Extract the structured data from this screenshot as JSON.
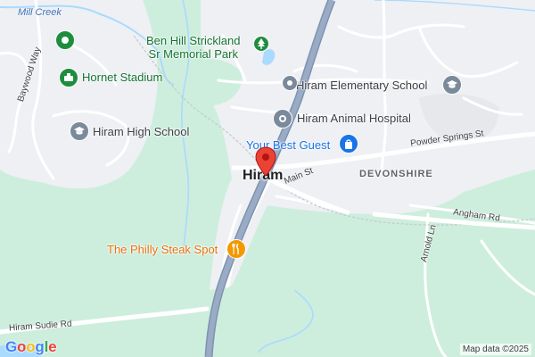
{
  "map": {
    "town": "Hiram",
    "neighborhood": "DEVONSHIRE",
    "places": [
      {
        "name": "Ben Hill Strickland",
        "name_line2": "Sr Memorial Park",
        "icon": "tree-icon",
        "color": "#1e8e3e"
      },
      {
        "name": "Hornet Stadium",
        "icon": "stadium-icon",
        "color": "#1e8e3e"
      },
      {
        "name": "Hiram High School",
        "icon": "school-icon",
        "color": "#7b8a9b"
      },
      {
        "name": "Hiram Elementary School",
        "icon": "school-icon",
        "color": "#7b8a9b"
      },
      {
        "name": "Hiram Animal Hospital",
        "icon": "medical-icon",
        "color": "#7b8a9b"
      },
      {
        "name": "Your Best Guest",
        "icon": "shopping-bag-icon",
        "color": "#1a73e8"
      },
      {
        "name": "The Philly Steak Spot",
        "icon": "restaurant-icon",
        "color": "#f29900"
      }
    ],
    "roads": {
      "mill_creek": "Mill Creek",
      "baywood": "Baywood Way",
      "powder_springs": "Powder Springs St",
      "main": "Main St",
      "angham": "Angham Rd",
      "arnold": "Arnold Ln",
      "hiram_sudie": "Hiram Sudie Rd"
    },
    "attribution": "Map data ©2025",
    "logo": {
      "letters": [
        "G",
        "o",
        "o",
        "g",
        "l",
        "e"
      ],
      "colors": [
        "#4285f4",
        "#ea4335",
        "#fbbc05",
        "#4285f4",
        "#34a853",
        "#ea4335"
      ]
    },
    "colors": {
      "land": "#cdeedd",
      "urban": "#eef0f3",
      "road": "#ffffff",
      "highway": "#8fa2bd",
      "water": "#aadaff",
      "pin": "#ea4335"
    }
  }
}
